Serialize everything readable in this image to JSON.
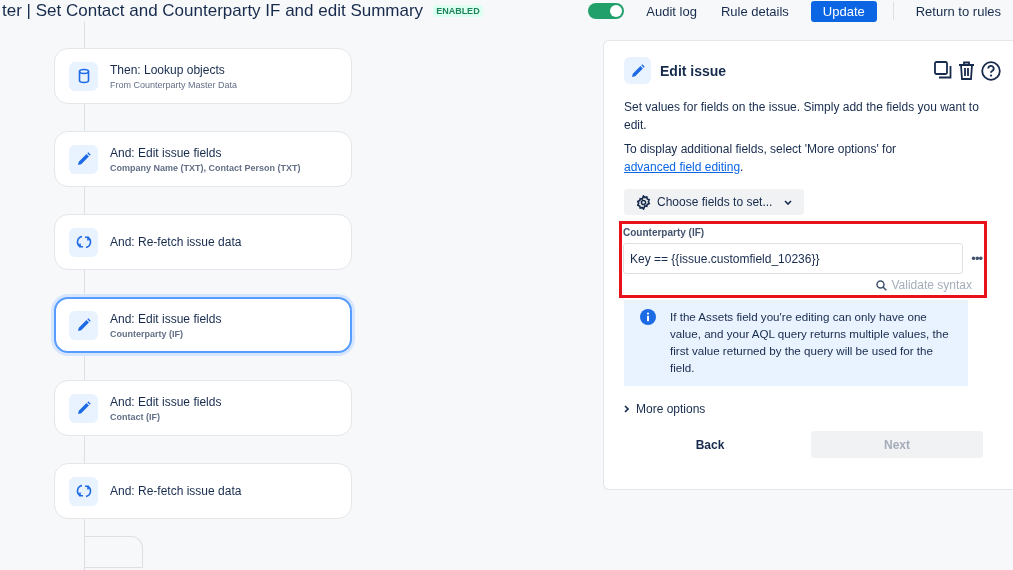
{
  "header": {
    "title": "ter | Set Contact and Counterparty IF and edit Summary",
    "status": "ENABLED",
    "toggle": {
      "on": true
    },
    "links": [
      "Audit log",
      "Rule details"
    ],
    "primary_button": "Update",
    "return_link": "Return to rules"
  },
  "flow": [
    {
      "kind": "lookup",
      "title": "Then: Lookup objects",
      "subtitle": "From Counterparty Master Data",
      "selected": false
    },
    {
      "kind": "edit",
      "title": "And: Edit issue fields",
      "subtitle": "Company Name (TXT), Contact Person (TXT)",
      "selected": false
    },
    {
      "kind": "refetch",
      "title": "And: Re-fetch issue data",
      "selected": false
    },
    {
      "kind": "edit",
      "title": "And: Edit issue fields",
      "subtitle": "Counterparty (IF)",
      "selected": true
    },
    {
      "kind": "edit",
      "title": "And: Edit issue fields",
      "subtitle": "Contact (IF)",
      "selected": false
    },
    {
      "kind": "refetch",
      "title": "And: Re-fetch issue data",
      "selected": false
    }
  ],
  "panel": {
    "title": "Edit issue",
    "description": "Set values for fields on the issue. Simply add the fields you want to edit.",
    "hint": "To display additional fields, select 'More options' for ",
    "hint_link": "advanced field editing",
    "hint_end": ".",
    "choose_button": "Choose fields to set...",
    "field": {
      "label": "Counterparty (IF)",
      "value": "Key == {{issue.customfield_10236}}",
      "more": "•••",
      "validate": "Validate syntax",
      "highlighted": true
    },
    "info": "If the Assets field you're editing can only have one value, and your AQL query returns multiple values, the first value returned by the query will be used for the field.",
    "more_options": "More options",
    "back": "Back",
    "next": "Next"
  }
}
